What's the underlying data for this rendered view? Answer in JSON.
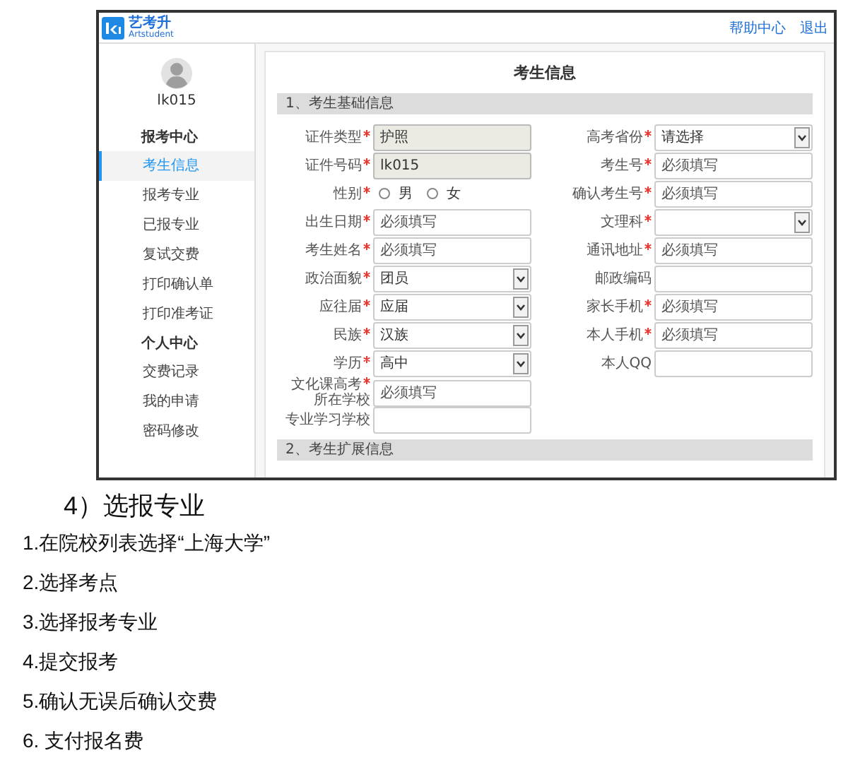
{
  "app": {
    "logo": {
      "name": "艺考升",
      "subtitle": "Artstudent"
    },
    "header_links": [
      "帮助中心",
      "退出"
    ],
    "user": {
      "name": "lk015"
    },
    "sidebar": [
      {
        "title": "报考中心",
        "items": [
          {
            "label": "考生信息",
            "selected": true
          },
          {
            "label": "报考专业",
            "selected": false
          },
          {
            "label": "已报专业",
            "selected": false
          },
          {
            "label": "复试交费",
            "selected": false
          },
          {
            "label": "打印确认单",
            "selected": false
          },
          {
            "label": "打印准考证",
            "selected": false
          }
        ]
      },
      {
        "title": "个人中心",
        "items": [
          {
            "label": "交费记录",
            "selected": false
          },
          {
            "label": "我的申请",
            "selected": false
          },
          {
            "label": "密码修改",
            "selected": false
          }
        ]
      }
    ],
    "main": {
      "title": "考生信息",
      "sections": [
        {
          "title": "1、考生基础信息",
          "left_fields": [
            {
              "label": "证件类型",
              "required": true,
              "kind": "readonly",
              "value": "护照"
            },
            {
              "label": "证件号码",
              "required": true,
              "kind": "readonly",
              "value": "lk015"
            },
            {
              "label": "性别",
              "required": true,
              "kind": "radio",
              "options": [
                {
                  "label": "男",
                  "selected": false
                },
                {
                  "label": "女",
                  "selected": false
                }
              ]
            },
            {
              "label": "出生日期",
              "required": true,
              "kind": "text",
              "placeholder": "必须填写"
            },
            {
              "label": "考生姓名",
              "required": true,
              "kind": "text",
              "placeholder": "必须填写"
            },
            {
              "label": "政治面貌",
              "required": true,
              "kind": "select",
              "value": "团员"
            },
            {
              "label": "应往届",
              "required": true,
              "kind": "select",
              "value": "应届"
            },
            {
              "label": "民族",
              "required": true,
              "kind": "select",
              "value": "汉族"
            },
            {
              "label": "学历",
              "required": true,
              "kind": "select",
              "value": "高中"
            },
            {
              "label": "文化课高考",
              "label_line2": "所在学校",
              "required": true,
              "kind": "text",
              "placeholder": "必须填写"
            },
            {
              "label": "专业学习学校",
              "required": false,
              "kind": "text"
            }
          ],
          "right_fields": [
            {
              "label": "高考省份",
              "required": true,
              "kind": "select",
              "value": "请选择"
            },
            {
              "label": "考生号",
              "required": true,
              "kind": "text",
              "placeholder": "必须填写"
            },
            {
              "label": "确认考生号",
              "required": true,
              "kind": "text",
              "placeholder": "必须填写"
            },
            {
              "label": "文理科",
              "required": true,
              "kind": "select"
            },
            {
              "label": "通讯地址",
              "required": true,
              "kind": "text",
              "placeholder": "必须填写"
            },
            {
              "label": "邮政编码",
              "required": false,
              "kind": "text"
            },
            {
              "label": "家长手机",
              "required": true,
              "kind": "text",
              "placeholder": "必须填写"
            },
            {
              "label": "本人手机",
              "required": true,
              "kind": "text",
              "placeholder": "必须填写"
            },
            {
              "label": "本人QQ",
              "required": false,
              "kind": "text"
            }
          ]
        },
        {
          "title": "2、考生扩展信息"
        }
      ]
    }
  },
  "doc": {
    "heading": "4）选报专业",
    "steps": [
      "1.在院校列表选择“上海大学”",
      "2.选择考点",
      "3.选择报考专业",
      "4.提交报考",
      "5.确认无误后确认交费",
      "6. 支付报名费"
    ]
  }
}
